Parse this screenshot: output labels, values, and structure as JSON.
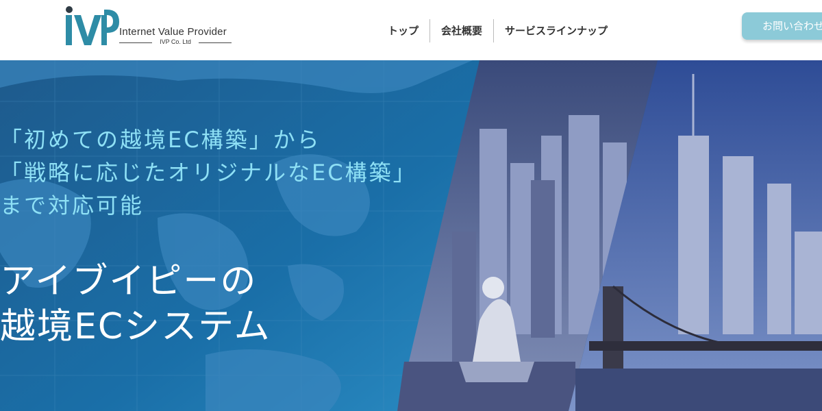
{
  "brand": {
    "name": "Internet Value Provider",
    "company": "IVP Co. Ltd",
    "primary_color": "#2e8ca6",
    "accent_color": "#8ccad8"
  },
  "nav": {
    "items": [
      {
        "label": "トップ"
      },
      {
        "label": "会社概要"
      },
      {
        "label": "サービスラインナップ"
      }
    ],
    "contact_label": "お問い合わせ"
  },
  "hero": {
    "line1": "「初めての越境EC構築」から",
    "line2": "「戦略に応じたオリジナルなEC構築」",
    "line3": "まで対応可能",
    "title1": "アイブイピーの",
    "title2": "越境ECシステム",
    "images": [
      {
        "icon": "world-map-icon"
      },
      {
        "icon": "singapore-merlion-cityscape"
      },
      {
        "icon": "new-york-bridge-cityscape"
      }
    ]
  }
}
